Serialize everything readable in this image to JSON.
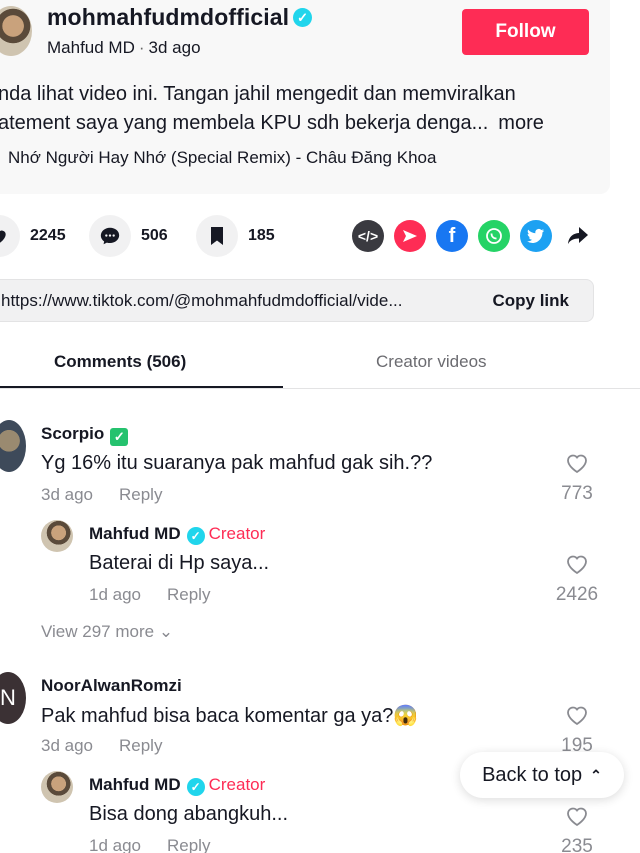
{
  "post": {
    "username": "mohmahfudmdofficial",
    "display_name": "Mahfud MD",
    "time_ago": "3d ago",
    "follow_label": "Follow",
    "description_line1": "nda lihat video ini. Tangan jahil mengedit dan memviralkan",
    "description_line2": "atement saya yang membela KPU sdh bekerja denga...",
    "more_label": "more",
    "music": "Nhớ Người Hay Nhớ (Special Remix) - Châu Đăng Khoa"
  },
  "stats": {
    "likes": "2245",
    "comments": "506",
    "saves": "185"
  },
  "share_icons": [
    "embed-icon",
    "send-icon",
    "facebook-icon",
    "whatsapp-icon",
    "twitter-icon",
    "share-arrow-icon"
  ],
  "link": {
    "url": "https://www.tiktok.com/@mohmahfudmdofficial/vide...",
    "copy_label": "Copy link"
  },
  "tabs": {
    "comments_label": "Comments (506)",
    "creator_label": "Creator videos"
  },
  "comments": [
    {
      "name": "Scorpio",
      "text": "Yg 16% itu suaranya pak mahfud gak sih.??",
      "time": "3d ago",
      "reply_label": "Reply",
      "likes": "773"
    },
    {
      "name": "Mahfud MD",
      "creator_tag": "Creator",
      "text": "Baterai di Hp saya...",
      "time": "1d ago",
      "reply_label": "Reply",
      "likes": "2426"
    },
    {
      "name": "NoorAlwanRomzi",
      "avatar_letter": "N",
      "text": "Pak mahfud bisa baca komentar ga ya?😱",
      "time": "3d ago",
      "reply_label": "Reply",
      "likes": "195"
    },
    {
      "name": "Mahfud MD",
      "creator_tag": "Creator",
      "text": "Bisa dong abangkuh...",
      "time": "1d ago",
      "reply_label": "Reply",
      "likes": "235"
    }
  ],
  "view_more": "View 297 more",
  "back_to_top": "Back to top",
  "colors": {
    "accent": "#fe2c55",
    "verified": "#20d5ec",
    "muted": "#8a8b91"
  }
}
